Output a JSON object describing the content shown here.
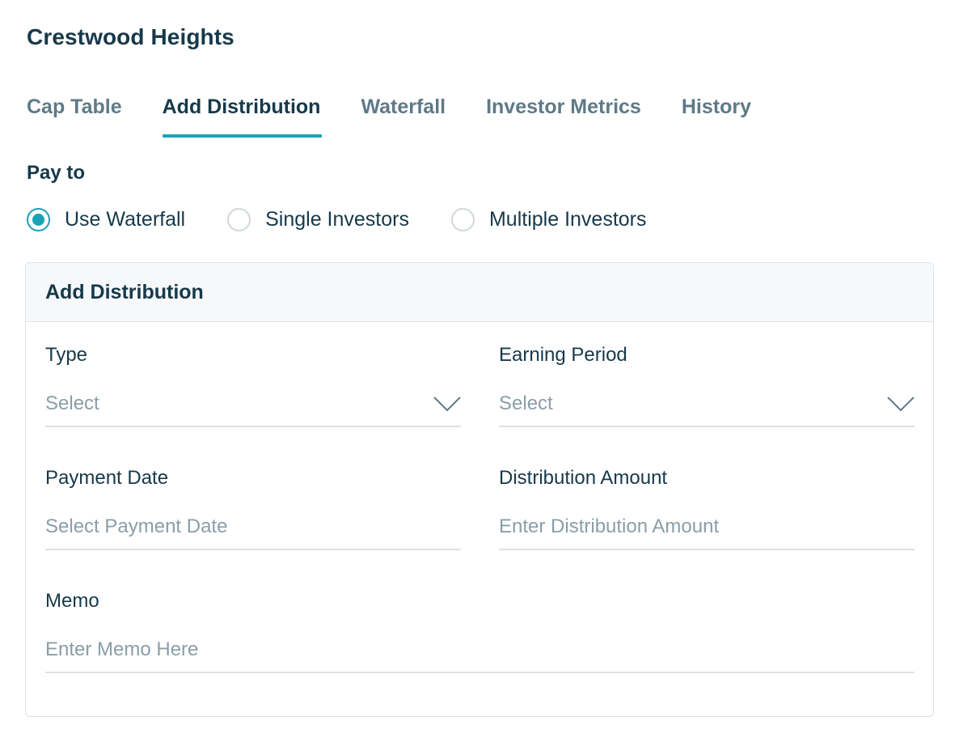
{
  "page": {
    "title": "Crestwood Heights"
  },
  "tabs": [
    {
      "label": "Cap Table",
      "active": false
    },
    {
      "label": "Add Distribution",
      "active": true
    },
    {
      "label": "Waterfall",
      "active": false
    },
    {
      "label": "Investor Metrics",
      "active": false
    },
    {
      "label": "History",
      "active": false
    }
  ],
  "pay_to": {
    "label": "Pay to",
    "options": [
      {
        "label": "Use Waterfall",
        "checked": true
      },
      {
        "label": "Single Investors",
        "checked": false
      },
      {
        "label": "Multiple Investors",
        "checked": false
      }
    ]
  },
  "form": {
    "title": "Add Distribution",
    "type": {
      "label": "Type",
      "value": "Select"
    },
    "earning_period": {
      "label": "Earning Period",
      "value": "Select"
    },
    "payment_date": {
      "label": "Payment Date",
      "placeholder": "Select Payment Date"
    },
    "distribution_amount": {
      "label": "Distribution Amount",
      "placeholder": "Enter Distribution Amount"
    },
    "memo": {
      "label": "Memo",
      "placeholder": "Enter Memo Here"
    }
  },
  "icons": {
    "dropdown": "chevron-down-icon"
  },
  "colors": {
    "accent": "#1aa3b4",
    "text": "#16394a",
    "muted": "#5e7a86"
  }
}
